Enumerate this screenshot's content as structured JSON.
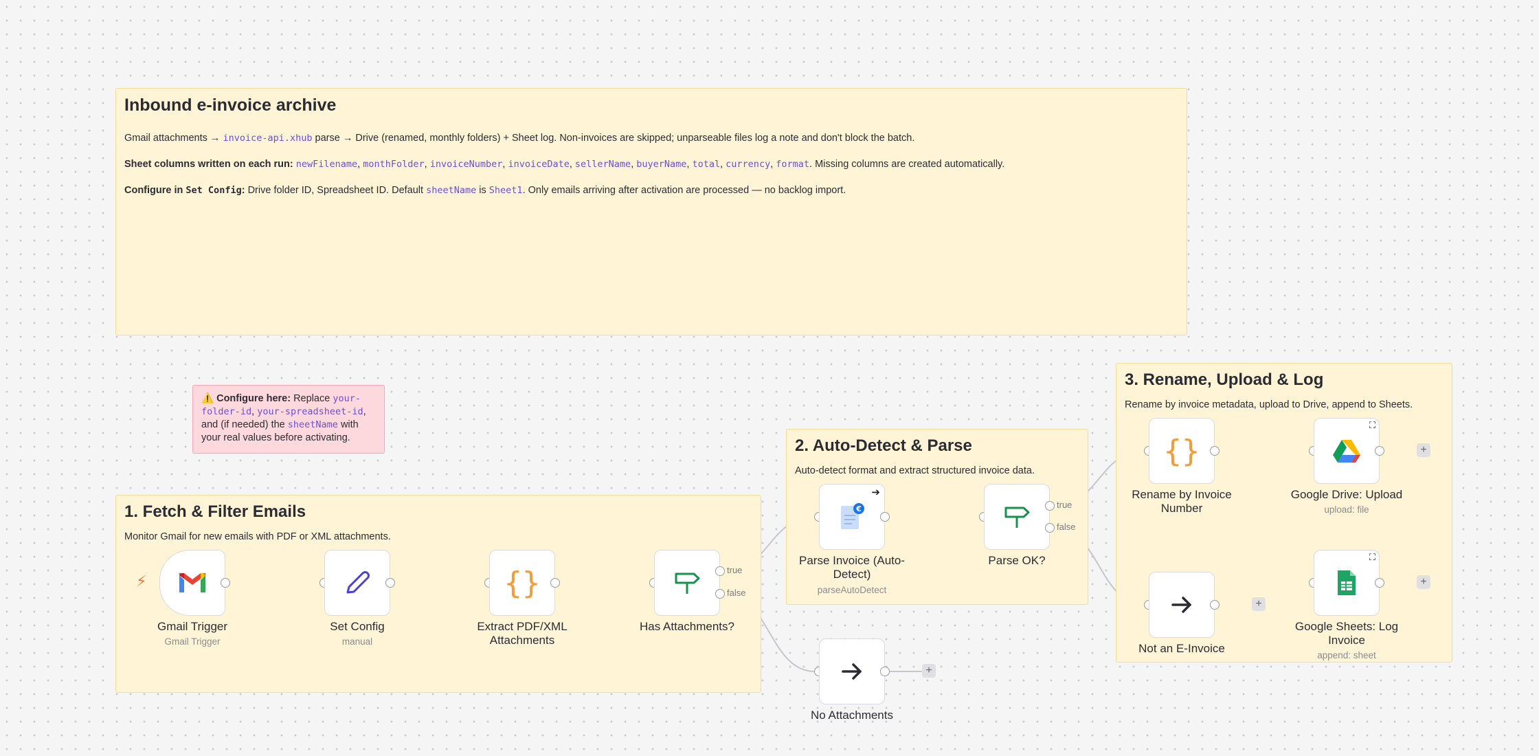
{
  "header_note": {
    "title": "Inbound e-invoice archive",
    "line1": {
      "a": "Gmail attachments → ",
      "code": "invoice-api.xhub",
      "b": " parse → Drive (renamed, monthly folders) + Sheet log. Non-invoices are skipped; unparseable files log a note and don't block the batch."
    },
    "line2": {
      "bold": "Sheet columns written on each run: ",
      "cols": [
        "newFilename",
        "monthFolder",
        "invoiceNumber",
        "invoiceDate",
        "sellerName",
        "buyerName",
        "total",
        "currency",
        "format"
      ],
      "sep": ", ",
      "tail": ". Missing columns are created automatically."
    },
    "line3": {
      "bold_a": "Configure in ",
      "code_bold": "Set Config",
      "bold_b": ":",
      "a": " Drive folder ID, Spreadsheet ID. Default ",
      "code1": "sheetName",
      "b": " is ",
      "code2": "Sheet1",
      "c": ". Only emails arriving after activation are processed — no backlog import."
    }
  },
  "warning_note": {
    "icon": "⚠️",
    "bold": "Configure here:",
    "a": " Replace ",
    "code1": "your-folder-id",
    "sep": ", ",
    "code2": "your-spreadsheet-id",
    "b": ", and (if needed) the ",
    "code3": "sheetName",
    "c": " with your real values before activating."
  },
  "section1": {
    "title": "1. Fetch & Filter Emails",
    "desc": "Monitor Gmail for new emails with PDF or XML attachments."
  },
  "section2": {
    "title": "2. Auto-Detect & Parse",
    "desc": "Auto-detect format and extract structured invoice data."
  },
  "section3": {
    "title": "3. Rename, Upload & Log",
    "desc": "Rename by invoice metadata, upload to Drive, append to Sheets."
  },
  "nodes": {
    "gmail": {
      "label": "Gmail Trigger",
      "sub": "Gmail Trigger"
    },
    "setconfig": {
      "label": "Set Config",
      "sub": "manual"
    },
    "extract": {
      "label": "Extract PDF/XML Attachments",
      "sub": ""
    },
    "hasatt": {
      "label": "Has Attachments?",
      "sub": ""
    },
    "noatt": {
      "label": "No Attachments",
      "sub": ""
    },
    "parse": {
      "label": "Parse Invoice (Auto-Detect)",
      "sub": "parseAutoDetect"
    },
    "parseok": {
      "label": "Parse OK?",
      "sub": ""
    },
    "rename": {
      "label": "Rename by Invoice Number",
      "sub": ""
    },
    "notinv": {
      "label": "Not an E-Invoice",
      "sub": ""
    },
    "drive": {
      "label": "Google Drive: Upload",
      "sub": "upload: file"
    },
    "sheets": {
      "label": "Google Sheets: Log Invoice",
      "sub": "append: sheet"
    }
  },
  "branches": {
    "true": "true",
    "false": "false"
  },
  "colors": {
    "sticky": "#fff5d6",
    "warning": "#fdd9dd",
    "code": "#6b4fd8",
    "edge": "#c4c4c9"
  }
}
